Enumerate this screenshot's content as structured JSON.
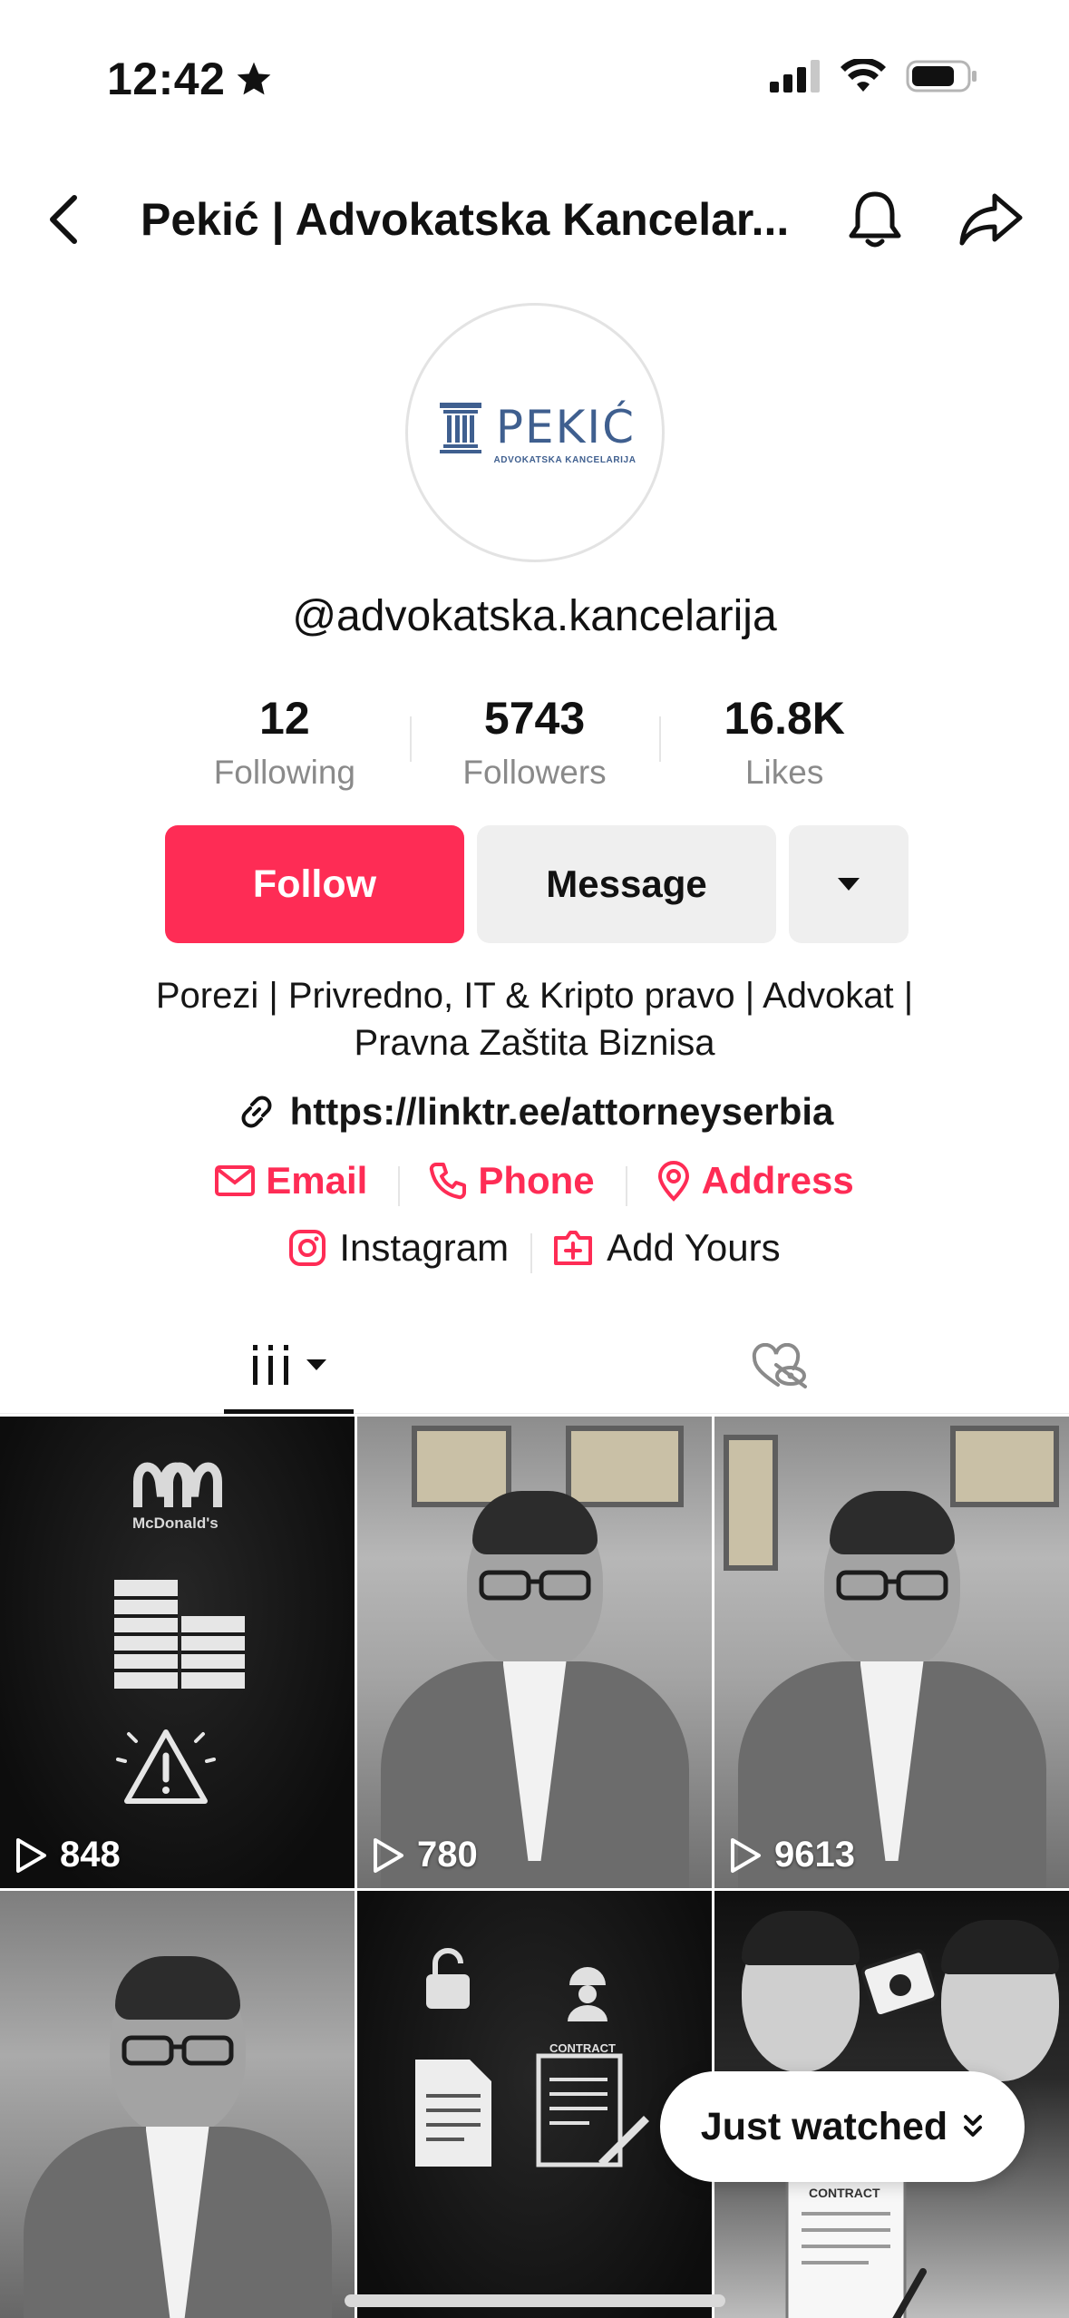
{
  "status_bar": {
    "time": "12:42",
    "icons": [
      "star-icon",
      "signal-icon",
      "wifi-icon",
      "battery-icon"
    ]
  },
  "header": {
    "title": "Pekić | Advokatska Kancelar...",
    "icons": [
      "back-chevron-icon",
      "bell-icon",
      "share-icon"
    ]
  },
  "profile": {
    "logo_text": "PEKIĆ",
    "logo_subtext": "ADVOKATSKA KANCELARIJA",
    "username": "@advokatska.kancelarija",
    "stats": [
      {
        "value": "12",
        "label": "Following"
      },
      {
        "value": "5743",
        "label": "Followers"
      },
      {
        "value": "16.8K",
        "label": "Likes"
      }
    ],
    "buttons": {
      "follow": "Follow",
      "message": "Message"
    },
    "bio_line1": "Porezi | Privredno, IT & Kripto pravo | Advokat |",
    "bio_line2": "Pravna Zaštita Biznisa",
    "link": "https://linktr.ee/attorneyserbia",
    "contacts": {
      "email": "Email",
      "phone": "Phone",
      "address": "Address"
    },
    "socials": {
      "instagram": "Instagram",
      "add_yours": "Add Yours"
    }
  },
  "tabs": [
    "videos-grid-icon",
    "liked-hidden-icon"
  ],
  "videos": [
    {
      "views": "848",
      "thumbnail_text": "McDonald's"
    },
    {
      "views": "780"
    },
    {
      "views": "9613"
    },
    {
      "views": ""
    },
    {
      "views": "",
      "thumbnail_text": "CONTRACT"
    },
    {
      "views": "",
      "thumbnail_text": "CONTRACT"
    }
  ],
  "floating": {
    "just_watched": "Just watched"
  },
  "colors": {
    "accent": "#fe2c55",
    "button_gray": "#efefef",
    "muted_text": "#8a8a8a",
    "logo_blue": "#3f5f8f"
  }
}
